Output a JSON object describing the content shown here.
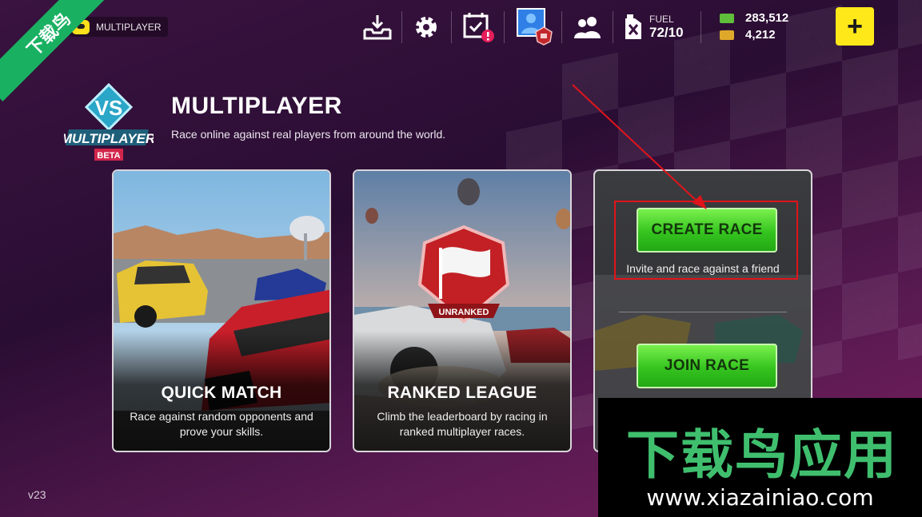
{
  "ribbon": {
    "text": "下载鸟"
  },
  "topbar": {
    "mode_label": "MULTIPLAYER",
    "fuel_label": "FUEL",
    "fuel_value": "72/10",
    "cash": "283,512",
    "gold": "4,212",
    "plus_label": "+",
    "icons": [
      "download-icon",
      "gear-icon",
      "calendar-check-icon",
      "profile-avatar",
      "friends-icon",
      "fuel-can-icon"
    ]
  },
  "header": {
    "badge_vs": "VS",
    "badge_name": "MULTIPLAYER",
    "badge_tag": "BETA",
    "title": "MULTIPLAYER",
    "subtitle": "Race online against real players from around the world."
  },
  "cards": [
    {
      "title": "QUICK MATCH",
      "description": "Race against random opponents and prove your skills."
    },
    {
      "title": "RANKED LEAGUE",
      "description": "Climb the leaderboard by racing in ranked multiplayer races.",
      "emblem_text": "UNRANKED"
    }
  ],
  "create_card": {
    "create_label": "CREATE RACE",
    "create_hint": "Invite and race against a friend",
    "join_label": "JOIN RACE"
  },
  "version": "v23",
  "watermark": {
    "brand": "下载鸟应用",
    "url": "www.xiazainiao.com"
  },
  "colors": {
    "accent_yellow": "#ffe81a",
    "green": "#35c41f",
    "highlight_red": "#e0141b",
    "bg": "#3a1340"
  }
}
